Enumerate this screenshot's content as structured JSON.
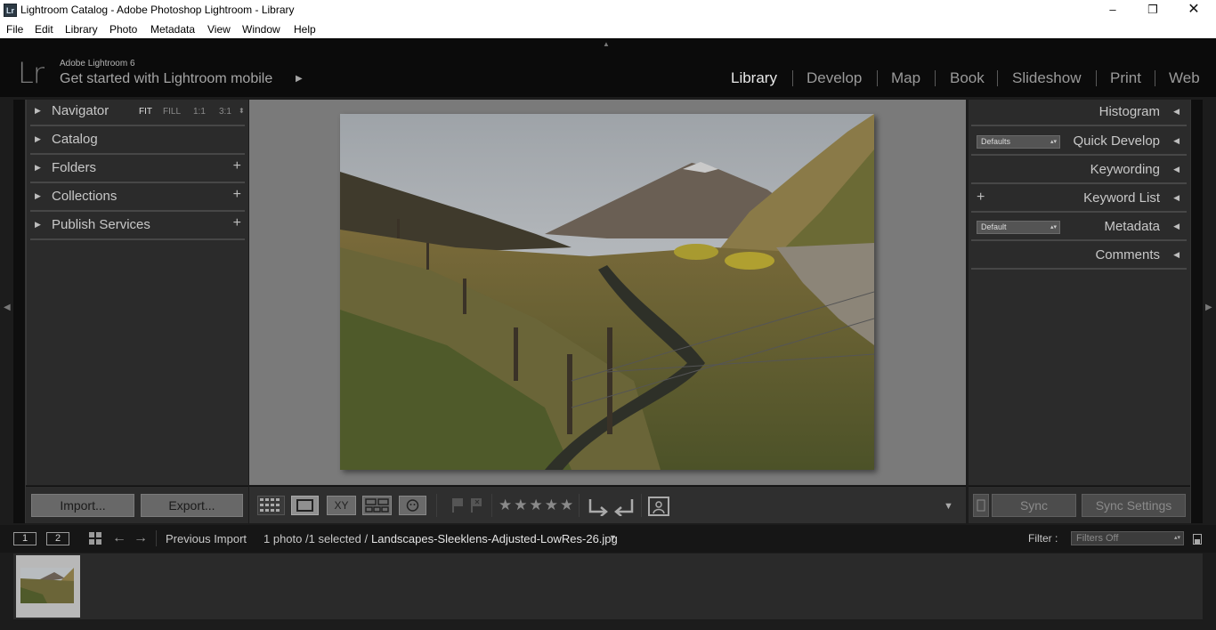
{
  "window": {
    "app_icon": "Lr",
    "title": "Lightroom Catalog - Adobe Photoshop Lightroom - Library",
    "buttons": [
      "minimize-icon",
      "restore-icon",
      "close-icon"
    ]
  },
  "menu": [
    "File",
    "Edit",
    "Library",
    "Photo",
    "Metadata",
    "View",
    "Window",
    "Help"
  ],
  "identity": {
    "logo": "Lr",
    "version": "Adobe Lightroom 6",
    "mobile": "Get started with Lightroom mobile"
  },
  "modules": [
    "Library",
    "Develop",
    "Map",
    "Book",
    "Slideshow",
    "Print",
    "Web"
  ],
  "active_module": "Library",
  "left_panel": {
    "navigator": {
      "label": "Navigator",
      "zoom": [
        "FIT",
        "FILL",
        "1:1",
        "3:1"
      ],
      "selected_zoom": "FIT"
    },
    "sections": [
      {
        "label": "Catalog"
      },
      {
        "label": "Folders"
      },
      {
        "label": "Collections"
      },
      {
        "label": "Publish Services"
      }
    ],
    "import_label": "Import...",
    "export_label": "Export..."
  },
  "right_panel": {
    "sections": [
      {
        "label": "Histogram"
      },
      {
        "label": "Quick Develop",
        "preset": "Defaults"
      },
      {
        "label": "Keywording"
      },
      {
        "label": "Keyword List"
      },
      {
        "label": "Metadata",
        "preset": "Default"
      },
      {
        "label": "Comments"
      }
    ],
    "sync_label": "Sync",
    "sync_settings_label": "Sync Settings"
  },
  "toolbar": {
    "icons": [
      "grid-view-icon",
      "loupe-view-icon",
      "compare-view-icon",
      "survey-view-icon",
      "people-view-icon",
      "flag-pick-icon",
      "flag-reject-icon",
      "rotate-left-icon",
      "rotate-right-icon",
      "crop-overlay-icon"
    ],
    "compare_label": "XY",
    "stars": "★★★★★"
  },
  "filmstrip_bar": {
    "monitor_1": "1",
    "monitor_2": "2",
    "source": "Previous Import",
    "count": "1 photo /1 selected /",
    "filename": "Landscapes-Sleeklens-Adjusted-LowRes-26.jpg",
    "filter_label": "Filter :",
    "filter_value": "Filters Off"
  },
  "colors": {
    "background": "#1c1c1c",
    "panel": "#2b2b2b",
    "center_bg": "#7a7a7a",
    "active_module": "#e8e8e8"
  }
}
